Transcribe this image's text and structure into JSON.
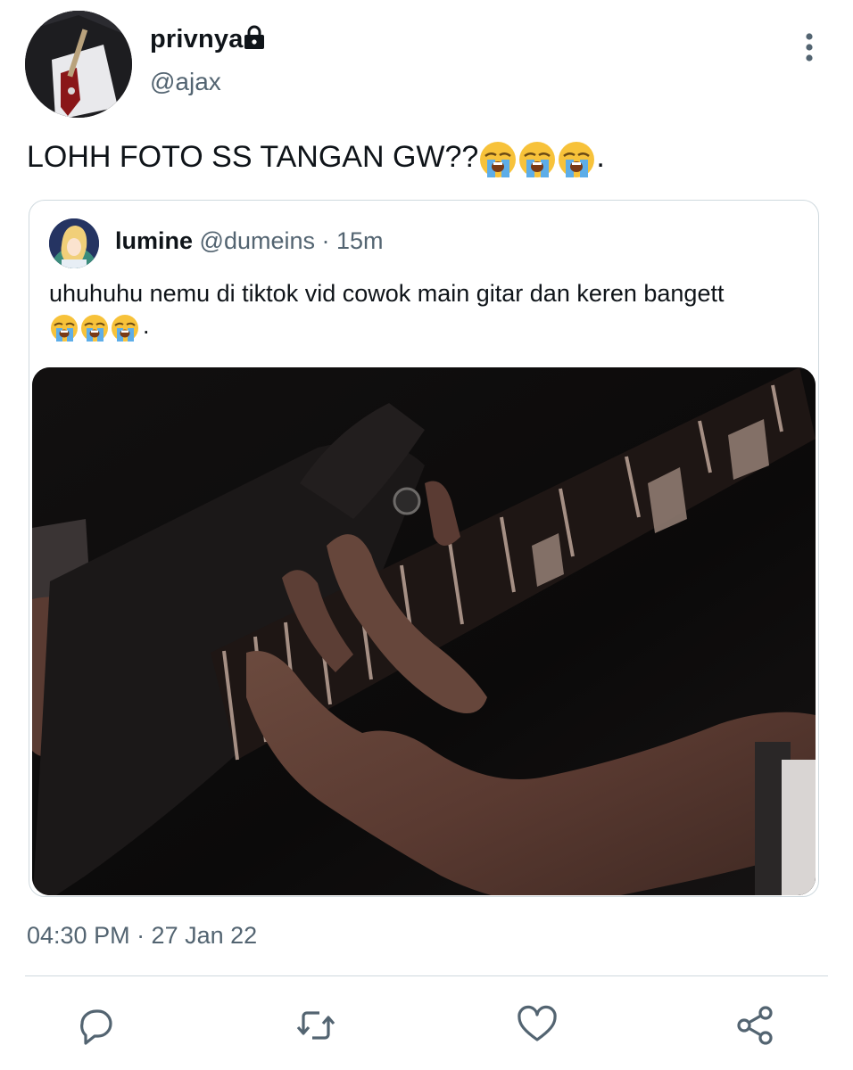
{
  "tweet": {
    "display_name": "privnya",
    "handle": "@ajax",
    "text": "LOHH FOTO SS TANGAN GW??",
    "text_suffix": ".",
    "emoji": [
      "loudly-crying-face",
      "loudly-crying-face",
      "loudly-crying-face"
    ],
    "timestamp": "04:30 PM · 27 Jan 22"
  },
  "quote": {
    "display_name": "lumine",
    "handle": "@dumeins",
    "time": " · 15m",
    "text": "uhuhuhu nemu di tiktok vid cowok main gitar dan keren bangett",
    "text_suffix": "."
  },
  "icons": {
    "lock": "lock-icon",
    "more": "more-vertical-icon",
    "reply": "reply-icon",
    "retweet": "retweet-icon",
    "like": "heart-icon",
    "share": "share-icon"
  },
  "colors": {
    "text": "#0f1419",
    "secondary": "#536471",
    "border": "#cfd9de",
    "icon": "#536471"
  }
}
